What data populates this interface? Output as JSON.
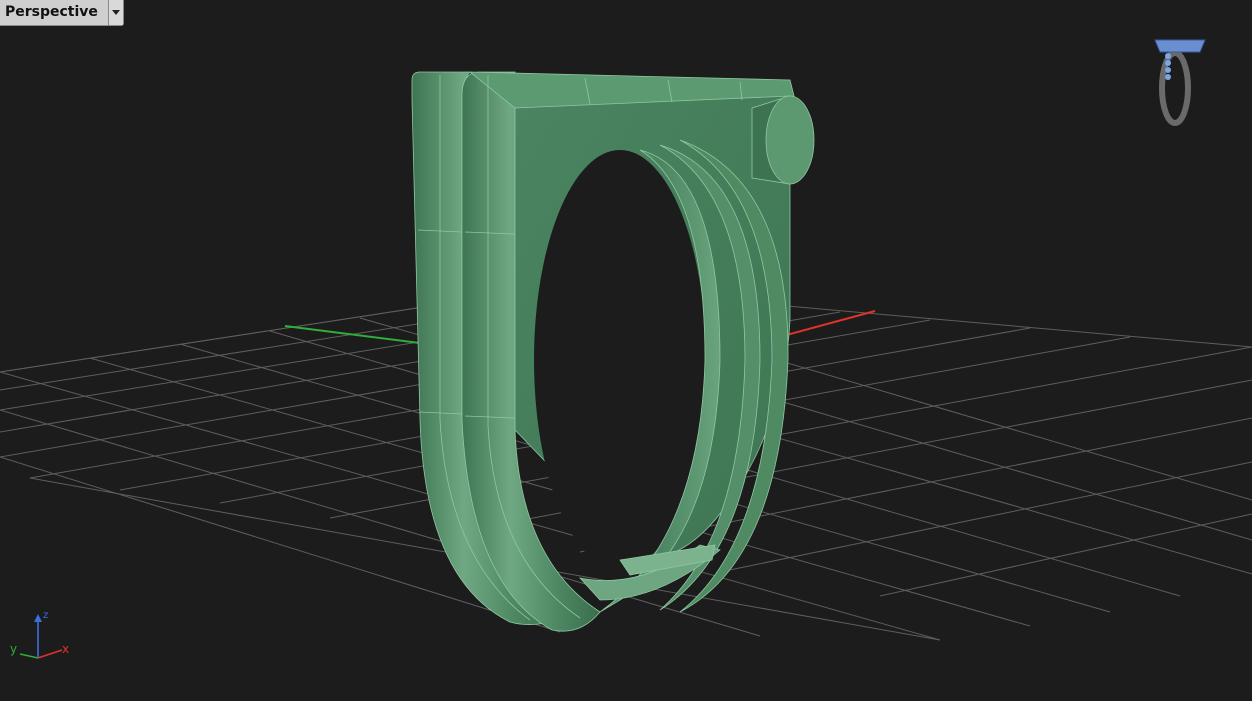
{
  "viewport": {
    "name": "Perspective",
    "menu_icon": "chevron-down-icon",
    "background": "#1c1c1c"
  },
  "axis_indicator": {
    "x_label": "x",
    "y_label": "y",
    "z_label": "z",
    "x_color": "#e0342a",
    "y_color": "#2fae3a",
    "z_color": "#3a6fe0"
  },
  "model": {
    "color": "#4f8a63",
    "edge_color": "#8fc7a1"
  },
  "thumbnail": {
    "icon": "ring-preview-icon"
  },
  "grid": {
    "line_color": "#6a6a6a",
    "x_axis_color": "#e0342a",
    "y_axis_color": "#2fae3a"
  }
}
